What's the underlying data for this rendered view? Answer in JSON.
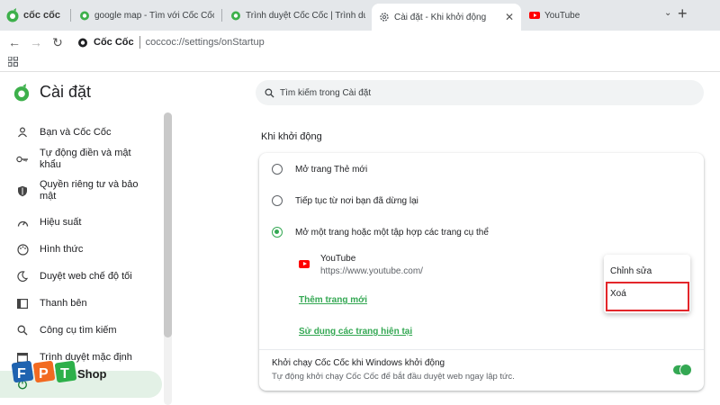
{
  "browser": {
    "brand": "cốc cốc",
    "tabs": [
      {
        "label": "google map - Tìm với Cốc Cốc",
        "active": false
      },
      {
        "label": "Trình duyệt Cốc Cốc | Trình duyệt",
        "active": false
      },
      {
        "label": "Cài đặt - Khi khởi động",
        "active": true
      },
      {
        "label": "YouTube",
        "active": false
      }
    ],
    "new_tab_symbol": "+",
    "omnibox": {
      "brand": "Cốc Cốc",
      "url": "coccoc://settings/onStartup"
    }
  },
  "sidebar": {
    "title": "Cài đặt",
    "items": [
      {
        "label": "Bạn và Cốc Cốc",
        "icon": "person-icon"
      },
      {
        "label": "Tự động điền và mật khẩu",
        "icon": "key-icon"
      },
      {
        "label": "Quyền riêng tư và bảo mật",
        "icon": "shield-icon"
      },
      {
        "label": "Hiệu suất",
        "icon": "speedometer-icon"
      },
      {
        "label": "Hình thức",
        "icon": "palette-icon"
      },
      {
        "label": "Duyệt web chế độ tối",
        "icon": "moon-icon"
      },
      {
        "label": "Thanh bên",
        "icon": "sidebar-panel-icon"
      },
      {
        "label": "Công cụ tìm kiếm",
        "icon": "search-icon"
      },
      {
        "label": "Trình duyệt mặc định",
        "icon": "browser-window-icon"
      }
    ]
  },
  "search": {
    "placeholder": "Tìm kiếm trong Cài đặt"
  },
  "startup": {
    "section_title": "Khi khởi động",
    "options": [
      {
        "label": "Mở trang Thẻ mới",
        "checked": false
      },
      {
        "label": "Tiếp tục từ nơi bạn đã dừng lại",
        "checked": false
      },
      {
        "label": "Mở một trang hoặc một tập hợp các trang cụ thể",
        "checked": true
      }
    ],
    "page": {
      "name": "YouTube",
      "url": "https://www.youtube.com/"
    },
    "add_page_link": "Thêm trang mới",
    "use_current_link": "Sử dụng các trang hiện tại",
    "windows_startup": {
      "title": "Khởi chạy Cốc Cốc khi Windows khởi động",
      "description": "Tự động khởi chạy Cốc Cốc để bắt đầu duyệt web ngay lập tức.",
      "enabled": true
    }
  },
  "context_menu": {
    "items": [
      "Chỉnh sửa",
      "Xoá"
    ],
    "highlighted": "Xoá"
  },
  "overlay": {
    "logo": "FPT Shop"
  },
  "colors": {
    "accent": "#34a853",
    "highlight": "#e3262a",
    "tabstrip": "#e4e7ea"
  }
}
